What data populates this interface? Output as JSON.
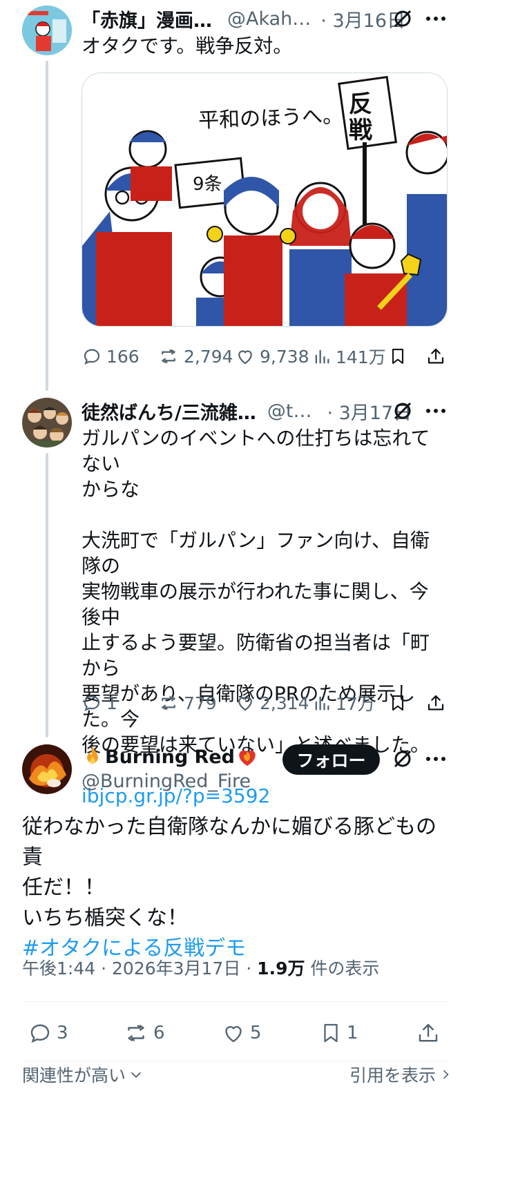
{
  "tweets": [
    {
      "name": "「赤旗」漫画…",
      "handle": "@Akah…",
      "date": "· 3月16日",
      "text": "オタクです。戦争反対。",
      "media_caption": "平和のほうへ。",
      "media_sign_left": "9条",
      "media_sign_right": "反戦",
      "stats": {
        "replies": "166",
        "reposts": "2,794",
        "likes": "9,738",
        "views": "141万"
      }
    },
    {
      "name": "徒然ばんち/三流雑…",
      "handle": "@t…",
      "date": "· 3月17日",
      "text_lines": [
        "ガルパンのイベントへの仕打ちは忘れてない",
        "からな",
        "",
        "大洗町で「ガルパン」ファン向け、自衛隊の",
        "実物戦車の展示が行われた事に関し、今後中",
        "止するよう要望。防衛省の担当者は「町から",
        "要望があり、自衛隊のPRのため展示した。今",
        "後の要望は来ていない」と述べました。"
      ],
      "link": "ibjcp.gr.jp/?p=3592",
      "stats": {
        "replies": "1",
        "reposts": "779",
        "likes": "2,314",
        "views": "17万"
      }
    }
  ],
  "main": {
    "name": "Burning Red",
    "handle": "@BurningRed_Fire",
    "follow_label": "フォロー",
    "text_lines": [
      "従わなかった自衛隊なんかに媚びる豚どもの責",
      "任だ！！",
      "いちち楯突くな！"
    ],
    "hashtag": "#オタクによる反戦デモ",
    "meta_time": "午後1:44 · 2026年3月17日 · ",
    "meta_views": "1.9万",
    "meta_views_suffix": " 件の表示",
    "stats": {
      "replies": "3",
      "reposts": "6",
      "likes": "5",
      "bookmarks": "1"
    }
  },
  "footer": {
    "sort_label": "関連性が高い",
    "quotes_label": "引用を表示"
  },
  "colors": {
    "link": "#1d9bf0",
    "text": "#0f1419",
    "muted": "#536471",
    "line": "#cfd9de",
    "red": "#c8211a",
    "blue": "#2f56a8"
  }
}
